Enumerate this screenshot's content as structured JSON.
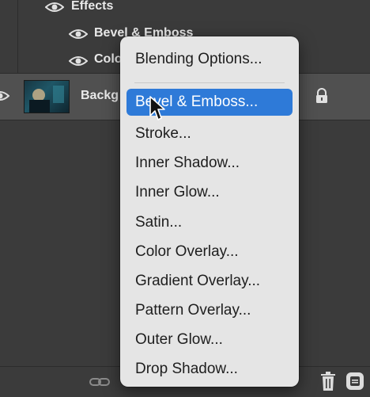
{
  "layers": {
    "effects_label": "Effects",
    "bevel_label": "Bevel & Emboss",
    "color_label": "Colo",
    "background_label": "Backg",
    "icons": {
      "visibility": "eye-icon",
      "lock": "lock-icon"
    }
  },
  "context_menu": {
    "items": [
      {
        "label": "Blending Options..."
      },
      {
        "label": "Bevel & Emboss...",
        "selected": true
      },
      {
        "label": "Stroke..."
      },
      {
        "label": "Inner Shadow..."
      },
      {
        "label": "Inner Glow..."
      },
      {
        "label": "Satin..."
      },
      {
        "label": "Color Overlay..."
      },
      {
        "label": "Gradient Overlay..."
      },
      {
        "label": "Pattern Overlay..."
      },
      {
        "label": "Outer Glow..."
      },
      {
        "label": "Drop Shadow..."
      }
    ]
  },
  "bottom_toolbar": {
    "icons": [
      "link-icon",
      "trash-icon",
      "adjustments-icon"
    ]
  },
  "colors": {
    "selection": "#2e7ad8",
    "menu_bg": "#e5e5e5",
    "panel_bg": "#3b3b3b"
  }
}
